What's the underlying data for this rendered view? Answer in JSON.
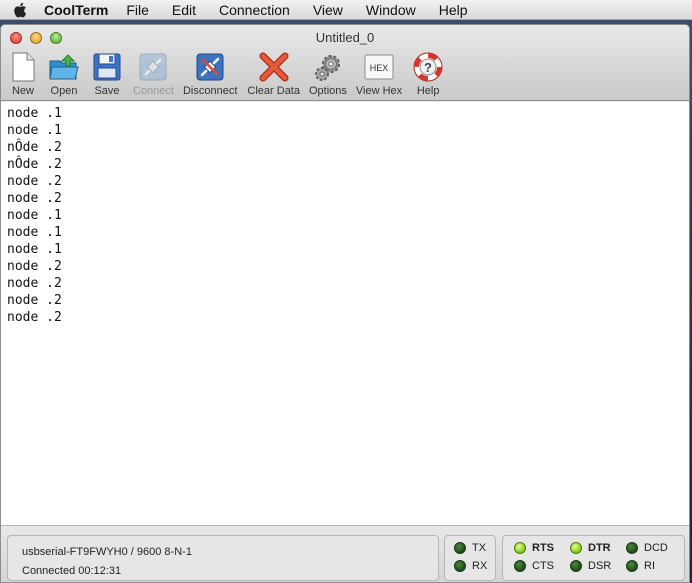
{
  "menubar": {
    "app_name": "CoolTerm",
    "items": [
      "File",
      "Edit",
      "Connection",
      "View",
      "Window",
      "Help"
    ]
  },
  "window": {
    "title": "Untitled_0"
  },
  "toolbar": {
    "buttons": [
      {
        "label": "New",
        "icon": "new-document-icon",
        "enabled": true
      },
      {
        "label": "Open",
        "icon": "open-folder-icon",
        "enabled": true
      },
      {
        "label": "Save",
        "icon": "floppy-disk-icon",
        "enabled": true
      },
      {
        "label": "Connect",
        "icon": "connect-plug-icon",
        "enabled": false
      },
      {
        "label": "Disconnect",
        "icon": "disconnect-plug-icon",
        "enabled": true
      },
      {
        "label": "Clear Data",
        "icon": "red-x-icon",
        "enabled": true
      },
      {
        "label": "Options",
        "icon": "gears-icon",
        "enabled": true
      },
      {
        "label": "View Hex",
        "icon": "hex-icon",
        "enabled": true
      },
      {
        "label": "Help",
        "icon": "lifebuoy-icon",
        "enabled": true
      }
    ],
    "hex_badge": "HEX",
    "help_glyph": "?"
  },
  "terminal": {
    "lines": [
      "node .1",
      "node .1",
      "nÔde .2",
      "nÔde .2",
      "node .2",
      "node .2",
      "node .1",
      "node .1",
      "node .1",
      "node .2",
      "node .2",
      "node .2",
      "node .2"
    ]
  },
  "status": {
    "port": "usbserial-FT9FWYH0 / 9600 8-N-1",
    "connection": "Connected 00:12:31"
  },
  "leds": {
    "tx": {
      "label": "TX",
      "on": false
    },
    "rx": {
      "label": "RX",
      "on": false
    },
    "rts": {
      "label": "RTS",
      "on": true
    },
    "dtr": {
      "label": "DTR",
      "on": true
    },
    "dcd": {
      "label": "DCD",
      "on": false
    },
    "cts": {
      "label": "CTS",
      "on": false
    },
    "dsr": {
      "label": "DSR",
      "on": false
    },
    "ri": {
      "label": "RI",
      "on": false
    }
  },
  "colors": {
    "led_on": "#9be22a",
    "led_off": "#2f6a24",
    "clear_red": "#e04a2f"
  }
}
